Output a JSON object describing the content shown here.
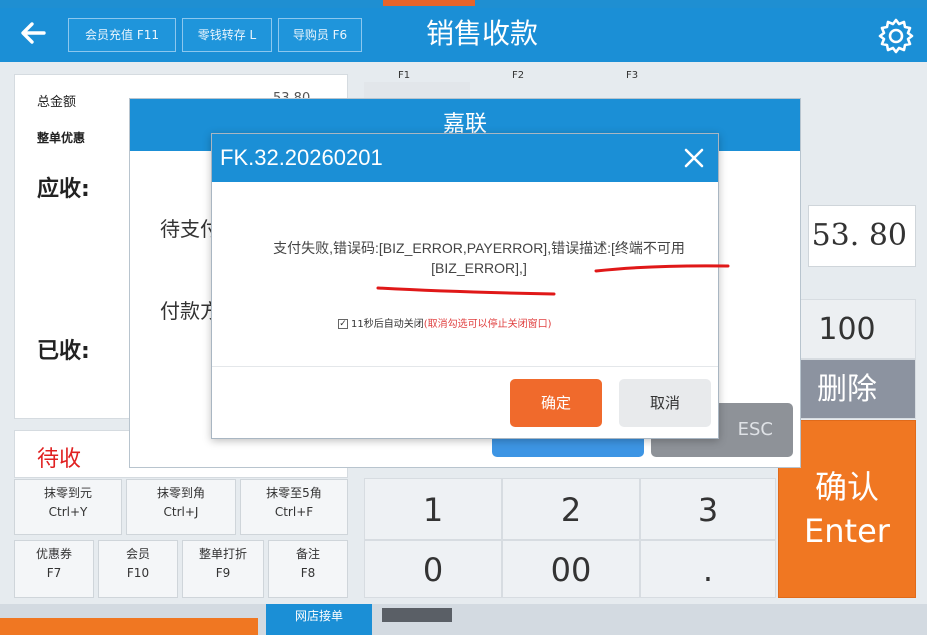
{
  "header": {
    "title": "销售收款",
    "buttons": [
      "会员充值 F11",
      "零钱转存 L",
      "导购员 F6"
    ]
  },
  "left_panel": {
    "total_label": "总金额",
    "total_value": "53.80",
    "discount_label": "整单优惠",
    "receivable_label": "应收:",
    "to_pay_label": "待支付",
    "pay_method_label": "付款方",
    "received_label": "已收:",
    "pending_label": "待收"
  },
  "fn_buttons": [
    {
      "label": "抹零到元",
      "key": "Ctrl+Y"
    },
    {
      "label": "抹零到角",
      "key": "Ctrl+J"
    },
    {
      "label": "抹零至5角",
      "key": "Ctrl+F"
    },
    {
      "label": "优惠券",
      "key": "F7"
    },
    {
      "label": "会员",
      "key": "F10"
    },
    {
      "label": "整单打折",
      "key": "F9"
    },
    {
      "label": "备注",
      "key": "F8"
    }
  ],
  "fkeys": [
    "F1",
    "F2",
    "F3"
  ],
  "amount_display": "53. 80",
  "keypad": {
    "keys": [
      "1",
      "2",
      "3",
      "0",
      "00",
      "."
    ],
    "quick_100": "100",
    "delete": "删除",
    "confirm": "确认",
    "confirm_key": "Enter"
  },
  "bottom": {
    "online_order": "网店接单"
  },
  "back_modal": {
    "title": "嘉联",
    "esc_label": "ESC"
  },
  "dialog": {
    "title": "FK.32.20260201",
    "message": "支付失败,错误码:[BIZ_ERROR,PAYERROR],错误描述:[终端不可用[BIZ_ERROR],]",
    "autoclose_text": "11秒后自动关闭",
    "autoclose_hint": "(取消勾选可以停止关闭窗口)",
    "ok_label": "确定",
    "cancel_label": "取消"
  },
  "colors": {
    "header_blue": "#1b8fd6",
    "accent_orange": "#f07722",
    "annotation_red": "#e01818"
  }
}
